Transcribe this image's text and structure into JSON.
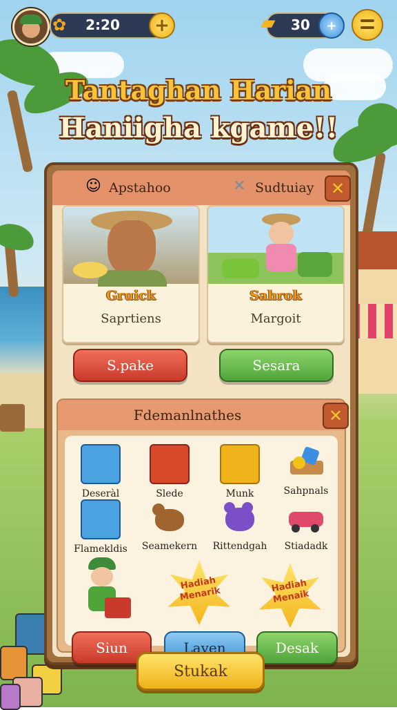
{
  "hud": {
    "timer": "2:20",
    "currency": "30"
  },
  "title": {
    "line1": "Tantaghan Harian",
    "line2": "Haniigha kgame!!"
  },
  "panel": {
    "tab_left": "Apstahoo",
    "tab_right": "Sudtuiay",
    "cards": [
      {
        "name": "Gruick",
        "subtitle": "Saprtiens"
      },
      {
        "name": "Sahrok",
        "subtitle": "Margoit"
      }
    ],
    "buttons": [
      "S.pake",
      "Sesara"
    ]
  },
  "rewards": {
    "title": "Fdemanlnathes",
    "items": [
      {
        "label": "Deseràl",
        "icon": "blue-crate-icon"
      },
      {
        "label": "Slede",
        "icon": "red-crate-icon"
      },
      {
        "label": "Munk",
        "icon": "gold-crate-icon"
      },
      {
        "label": "Sahpnals",
        "icon": "gem-tray-icon"
      },
      {
        "label": "Flamekldis",
        "icon": "blue-toy-crate-icon"
      },
      {
        "label": "Seamekern",
        "icon": "bear-toy-icon"
      },
      {
        "label": "Rittendgah",
        "icon": "purple-bear-icon"
      },
      {
        "label": "Stiadadk",
        "icon": "toy-car-icon"
      }
    ],
    "badges": [
      {
        "line1": "Hadiah",
        "line2": "Menarik"
      },
      {
        "line1": "Hadiah",
        "line2": "Menaik"
      }
    ],
    "buttons": [
      "Siun",
      "Laven",
      "Desak"
    ]
  },
  "bottom_button": "Stukak",
  "colors": {
    "accent_gold": "#f0b21a",
    "panel_brown": "#a0703f",
    "button_red": "#c9392a",
    "button_green": "#4fa43a",
    "button_blue": "#3b8fd3"
  }
}
